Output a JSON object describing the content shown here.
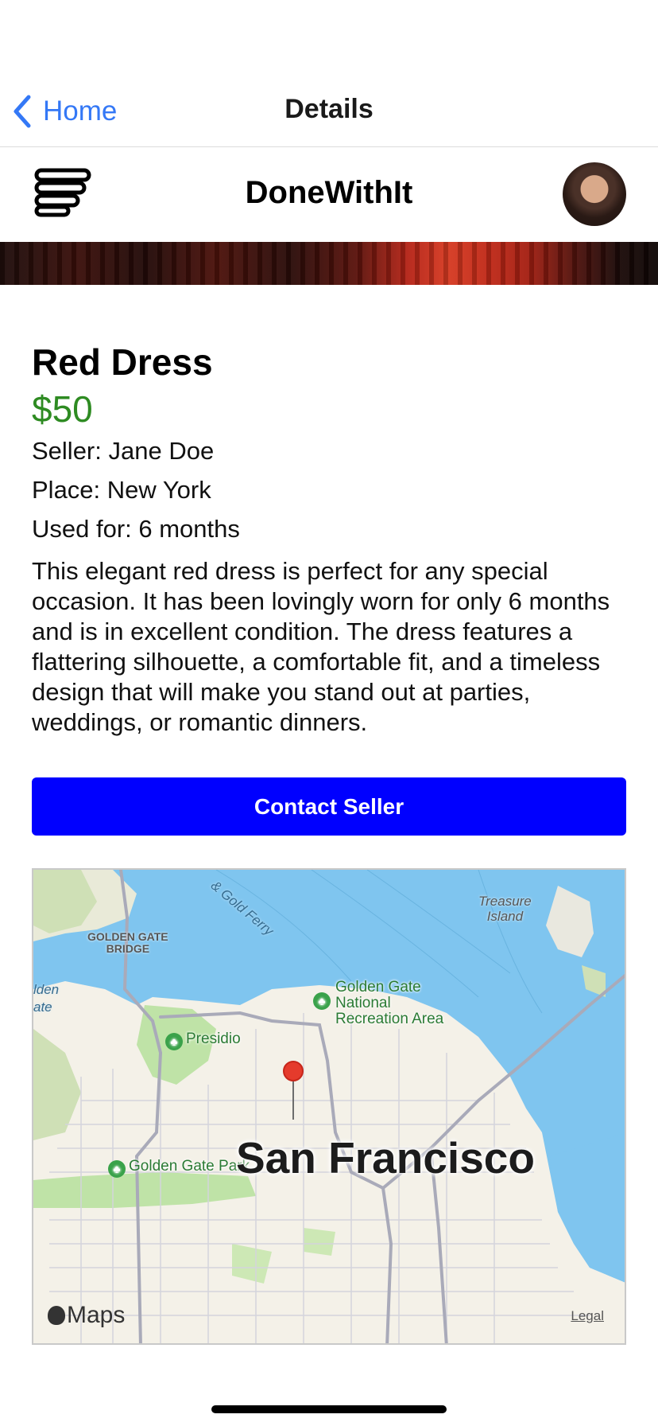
{
  "navbar": {
    "back_label": "Home",
    "title": "Details"
  },
  "header": {
    "brand": "DoneWithIt",
    "menu_icon": "hamburger-menu-icon",
    "avatar_icon": "user-avatar"
  },
  "item": {
    "title": "Red Dress",
    "price": "$50",
    "seller": "Seller: Jane Doe",
    "place": "Place: New York",
    "used_for": "Used for: 6 months",
    "description": "This elegant red dress is perfect for any special occasion. It has been lovingly worn for only 6 months and is in excellent condition. The dress features a flattering silhouette, a comfortable fit, and a timeless design that will make you stand out at parties, weddings, or romantic dinners.",
    "price_color": "#2e8b22"
  },
  "contact_button": {
    "label": "Contact Seller",
    "color": "#0000ff"
  },
  "map": {
    "city": "San Francisco",
    "labels": {
      "ferry": "& Gold Ferry",
      "treasure_island_1": "Treasure",
      "treasure_island_2": "Island",
      "ggb_1": "GOLDEN GATE",
      "ggb_2": "BRIDGE",
      "golden_gate_partial_1": "lden",
      "golden_gate_partial_2": "ate",
      "ggnra_1": "Golden Gate",
      "ggnra_2": "National",
      "ggnra_3": "Recreation Area",
      "presidio": "Presidio",
      "gg_park": "Golden Gate Park"
    },
    "attribution": "Maps",
    "legal": "Legal",
    "marker_color": "#e53b2c"
  }
}
